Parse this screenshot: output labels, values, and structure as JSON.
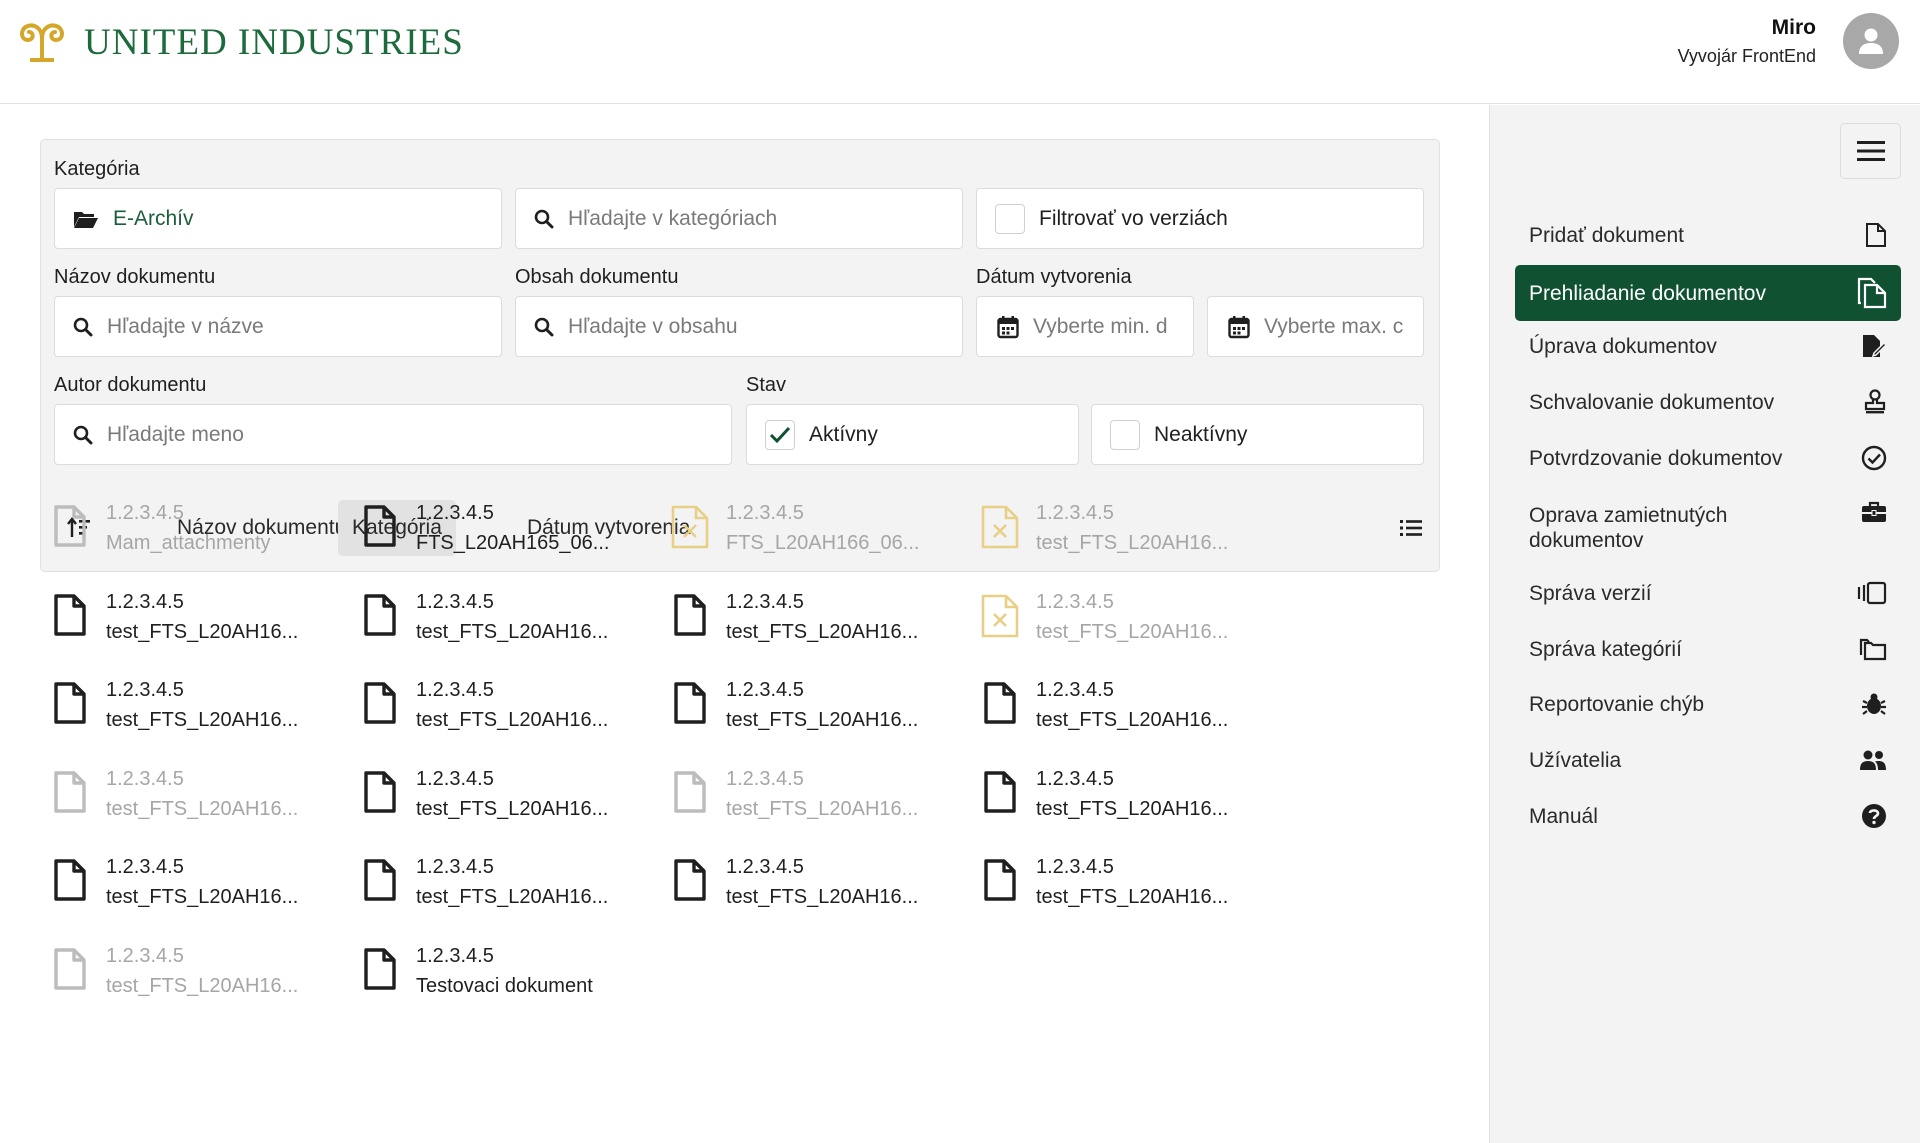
{
  "header": {
    "logo_text": "UNITED INDUSTRIES",
    "user_name": "Miro",
    "user_role": "Vyvojár FrontEnd"
  },
  "filters": {
    "category_label": "Kategória",
    "category_value": "E-Archív",
    "category_search_placeholder": "Hľadajte v kategóriach",
    "filter_versions_label": "Filtrovať vo verziách",
    "name_label": "Názov dokumentu",
    "name_placeholder": "Hľadajte v názve",
    "content_label": "Obsah dokumentu",
    "content_placeholder": "Hľadajte v obsahu",
    "date_label": "Dátum vytvorenia",
    "date_min_placeholder": "Vyberte min. d",
    "date_max_placeholder": "Vyberte max. c",
    "author_label": "Autor dokumentu",
    "author_placeholder": "Hľadajte meno",
    "status_label": "Stav",
    "status_active": "Aktívny",
    "status_inactive": "Neaktívny"
  },
  "sort": {
    "name": "Názov dokumentu",
    "category": "Kategória",
    "date": "Dátum vytvorenia"
  },
  "documents": [
    {
      "version": "1.2.3.4.5",
      "name": "Mam_attachmenty",
      "state": "dim"
    },
    {
      "version": "1.2.3.4.5",
      "name": "FTS_L20AH165_06...",
      "state": "ok"
    },
    {
      "version": "1.2.3.4.5",
      "name": "FTS_L20AH166_06...",
      "state": "err"
    },
    {
      "version": "1.2.3.4.5",
      "name": "test_FTS_L20AH16...",
      "state": "err"
    },
    {
      "version": "1.2.3.4.5",
      "name": "test_FTS_L20AH16...",
      "state": "ok"
    },
    {
      "version": "1.2.3.4.5",
      "name": "test_FTS_L20AH16...",
      "state": "ok"
    },
    {
      "version": "1.2.3.4.5",
      "name": "test_FTS_L20AH16...",
      "state": "ok"
    },
    {
      "version": "1.2.3.4.5",
      "name": "test_FTS_L20AH16...",
      "state": "err"
    },
    {
      "version": "1.2.3.4.5",
      "name": "test_FTS_L20AH16...",
      "state": "ok"
    },
    {
      "version": "1.2.3.4.5",
      "name": "test_FTS_L20AH16...",
      "state": "ok"
    },
    {
      "version": "1.2.3.4.5",
      "name": "test_FTS_L20AH16...",
      "state": "ok"
    },
    {
      "version": "1.2.3.4.5",
      "name": "test_FTS_L20AH16...",
      "state": "ok"
    },
    {
      "version": "1.2.3.4.5",
      "name": "test_FTS_L20AH16...",
      "state": "dim"
    },
    {
      "version": "1.2.3.4.5",
      "name": "test_FTS_L20AH16...",
      "state": "ok"
    },
    {
      "version": "1.2.3.4.5",
      "name": "test_FTS_L20AH16...",
      "state": "dim"
    },
    {
      "version": "1.2.3.4.5",
      "name": "test_FTS_L20AH16...",
      "state": "ok"
    },
    {
      "version": "1.2.3.4.5",
      "name": "test_FTS_L20AH16...",
      "state": "ok"
    },
    {
      "version": "1.2.3.4.5",
      "name": "test_FTS_L20AH16...",
      "state": "ok"
    },
    {
      "version": "1.2.3.4.5",
      "name": "test_FTS_L20AH16...",
      "state": "ok"
    },
    {
      "version": "1.2.3.4.5",
      "name": "test_FTS_L20AH16...",
      "state": "ok"
    },
    {
      "version": "1.2.3.4.5",
      "name": "test_FTS_L20AH16...",
      "state": "dim"
    },
    {
      "version": "1.2.3.4.5",
      "name": "Testovaci dokument",
      "state": "ok"
    }
  ],
  "sidebar": {
    "items": [
      {
        "label": "Pridať dokument",
        "icon": "file-add-icon"
      },
      {
        "label": "Prehliadanie dokumentov",
        "icon": "files-icon",
        "active": true
      },
      {
        "label": "Úprava dokumentov",
        "icon": "file-edit-icon"
      },
      {
        "label": "Schvalovanie dokumentov",
        "icon": "stamp-icon"
      },
      {
        "label": "Potvrdzovanie dokumentov",
        "icon": "check-circle-icon"
      },
      {
        "label": "Oprava zamietnutých dokumentov",
        "icon": "toolbox-icon"
      },
      {
        "label": "Správa verzií",
        "icon": "versions-icon"
      },
      {
        "label": "Správa kategórií",
        "icon": "folders-icon"
      },
      {
        "label": "Reportovanie chýb",
        "icon": "bug-icon"
      },
      {
        "label": "Užívatelia",
        "icon": "users-icon"
      },
      {
        "label": "Manuál",
        "icon": "help-icon"
      }
    ]
  },
  "colors": {
    "brand_green": "#0f5131",
    "logo_gold": "#d4a62a",
    "error_doc": "#e8cf86"
  }
}
